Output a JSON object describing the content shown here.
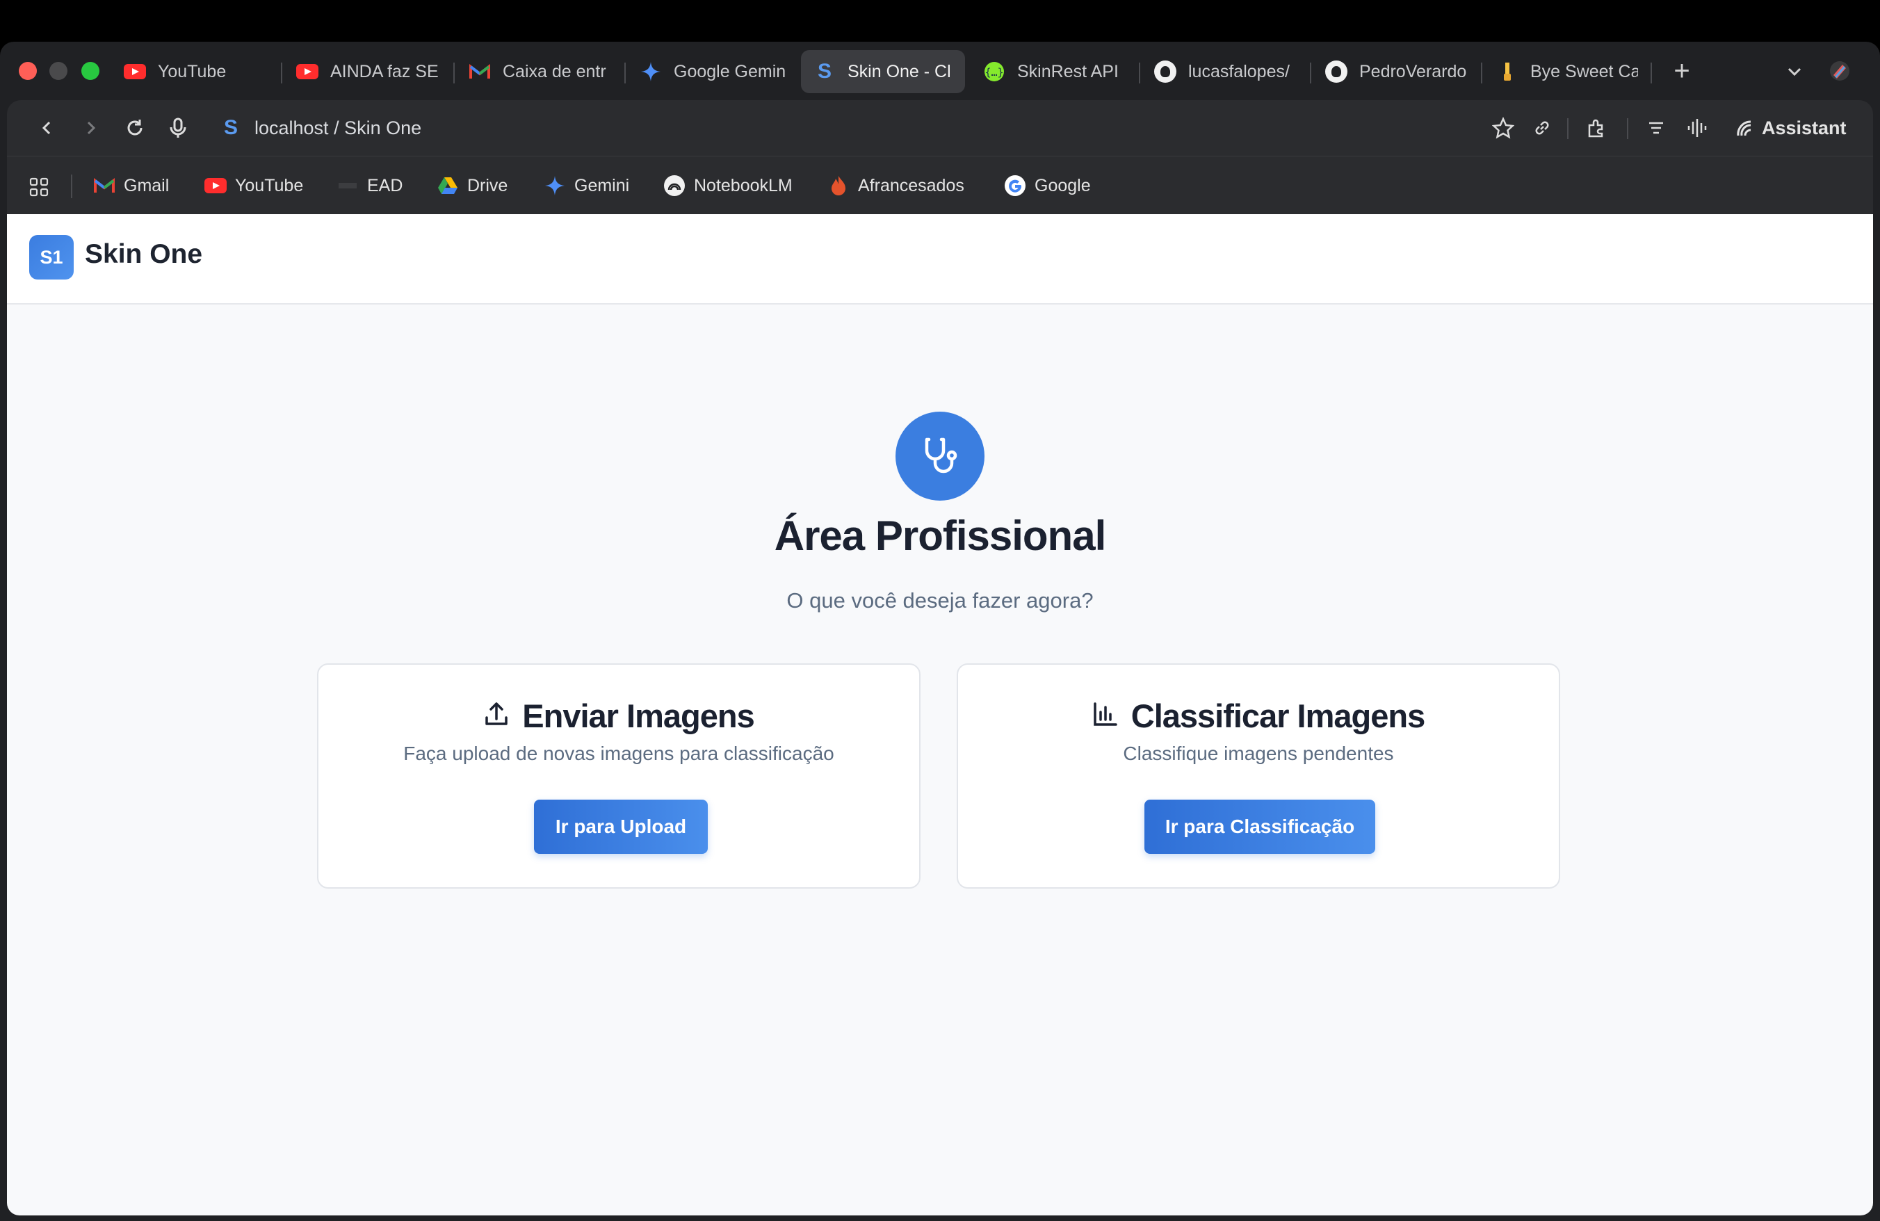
{
  "browser": {
    "tabs": [
      {
        "label": "YouTube",
        "icon": "youtube-icon",
        "active": false
      },
      {
        "label": "AINDA faz SE",
        "icon": "youtube-icon",
        "active": false
      },
      {
        "label": "Caixa de entr",
        "icon": "gmail-icon",
        "active": false
      },
      {
        "label": "Google Gemin",
        "icon": "gemini-icon",
        "active": false
      },
      {
        "label": "Skin One - Cl",
        "icon": "skinone-favicon",
        "active": true
      },
      {
        "label": "SkinRest API",
        "icon": "swagger-icon",
        "active": false
      },
      {
        "label": "lucasfalopes/",
        "icon": "github-icon",
        "active": false
      },
      {
        "label": "PedroVerardo",
        "icon": "github-icon",
        "active": false
      },
      {
        "label": "Bye Sweet Ca",
        "icon": "page-icon",
        "active": false
      }
    ],
    "address": {
      "favicon_letter": "S",
      "text": "localhost / Skin One"
    },
    "assistant_label": "Assistant",
    "bookmarks": [
      {
        "label": "Gmail",
        "icon": "gmail-icon"
      },
      {
        "label": "YouTube",
        "icon": "youtube-icon"
      },
      {
        "label": "EAD",
        "icon": "ead-icon"
      },
      {
        "label": "Drive",
        "icon": "drive-icon"
      },
      {
        "label": "Gemini",
        "icon": "gemini-icon"
      },
      {
        "label": "NotebookLM",
        "icon": "notebooklm-icon"
      },
      {
        "label": "Afrancesados",
        "icon": "flame-icon"
      },
      {
        "label": "Google",
        "icon": "google-icon"
      }
    ]
  },
  "app": {
    "logo_badge": "S1",
    "logo_text": "Skin One",
    "hero": {
      "icon": "stethoscope-icon",
      "title": "Área Profissional",
      "subtitle": "O que você deseja fazer agora?"
    },
    "cards": [
      {
        "icon": "upload-icon",
        "title": "Enviar Imagens",
        "description": "Faça upload de novas imagens para classificação",
        "button": "Ir para Upload"
      },
      {
        "icon": "bar-chart-icon",
        "title": "Classificar Imagens",
        "description": "Classifique imagens pendentes",
        "button": "Ir para Classificação"
      }
    ],
    "colors": {
      "accent": "#3b7ee0",
      "page_bg": "#f8f9fb",
      "text": "#1b2130",
      "muted": "#5b6b80"
    }
  }
}
